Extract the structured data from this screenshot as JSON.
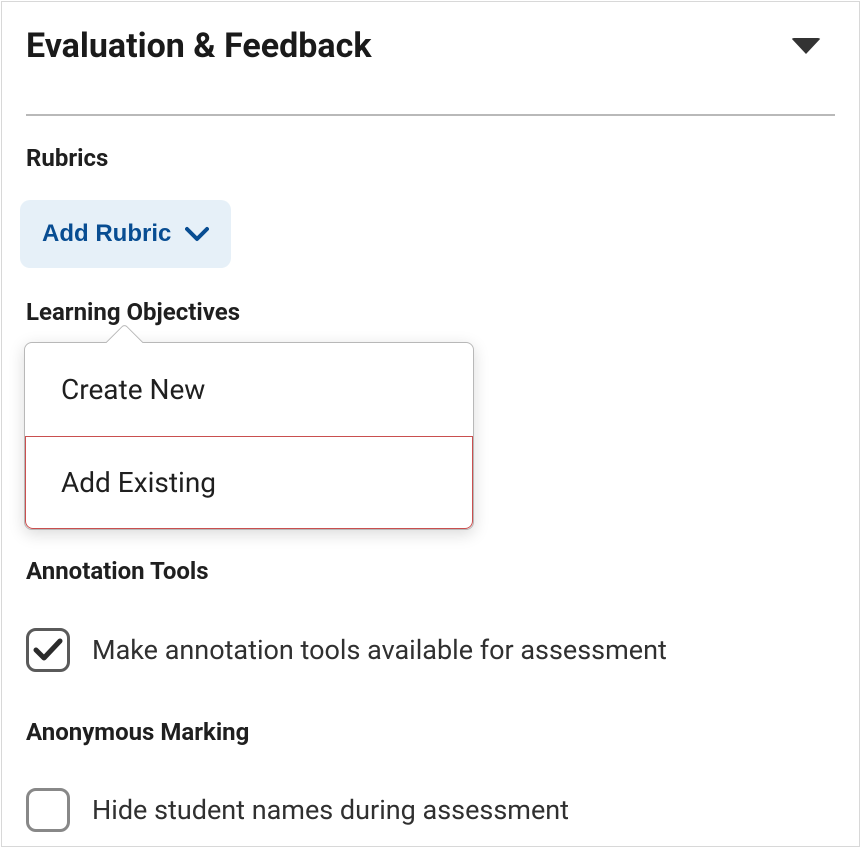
{
  "panel": {
    "title": "Evaluation & Feedback"
  },
  "rubrics": {
    "section_label": "Rubrics",
    "add_button_label": "Add Rubric",
    "menu": {
      "create_new": "Create New",
      "add_existing": "Add Existing"
    }
  },
  "learning_objectives": {
    "section_label": "Learning Objectives"
  },
  "annotation": {
    "section_label": "Annotation Tools",
    "checkbox_label": "Make annotation tools available for assessment",
    "checked": true
  },
  "anonymous": {
    "section_label": "Anonymous Marking",
    "checkbox_label": "Hide student names during assessment",
    "checked": false
  }
}
